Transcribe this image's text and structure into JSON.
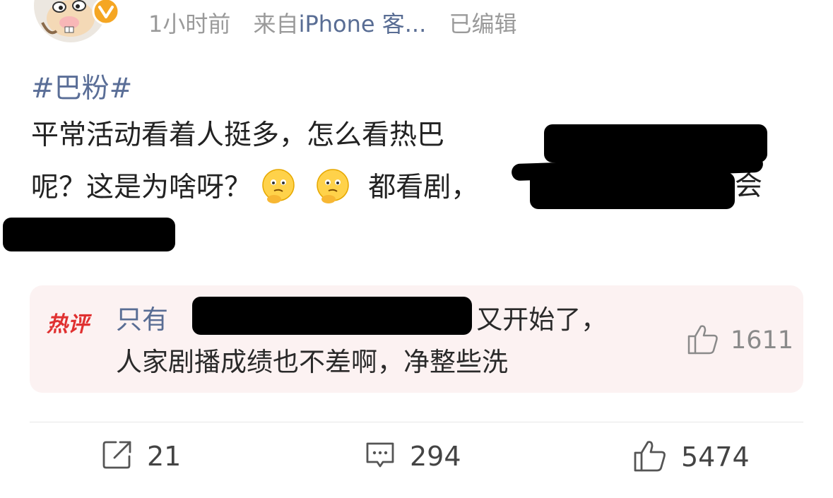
{
  "post": {
    "timestamp": "1小时前",
    "source_prefix": "来自",
    "source_device": "iPhone 客...",
    "edited": "已编辑",
    "hashtag": "#巴粉#",
    "line1": "平常活动看着人挺多，怎么看热巴",
    "line2_a": "呢？这是为啥呀？",
    "line2_b": "都看剧，",
    "line2_c": "会"
  },
  "hot_comment": {
    "badge": "热评",
    "user_prefix": "只有",
    "text_end": ": 又开始了，",
    "line2": "人家剧播成绩也不差啊，净整些洗",
    "likes": "1611"
  },
  "actions": {
    "reposts": "21",
    "comments": "294",
    "likes": "5474"
  },
  "colors": {
    "link": "#596d94",
    "hot_bg": "#fcf2f2",
    "hot_badge": "#e03030"
  },
  "icons": [
    "verified-badge-icon",
    "thinking-emoji-icon",
    "thumbs-up-icon",
    "share-icon",
    "comment-icon"
  ]
}
